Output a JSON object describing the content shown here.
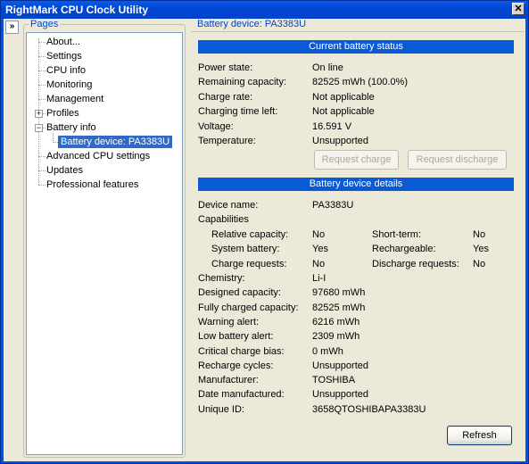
{
  "window": {
    "title": "RightMark CPU Clock Utility",
    "close_symbol": "✕",
    "collapse_symbol": "»"
  },
  "pages": {
    "legend": "Pages",
    "items": [
      {
        "label": "About..."
      },
      {
        "label": "Settings"
      },
      {
        "label": "CPU info"
      },
      {
        "label": "Monitoring"
      },
      {
        "label": "Management"
      },
      {
        "label": "Profiles",
        "expander": "+"
      },
      {
        "label": "Battery info",
        "expander": "−"
      },
      {
        "label": "Battery device: PA3383U",
        "selected": true
      },
      {
        "label": "Advanced CPU settings"
      },
      {
        "label": "Updates"
      },
      {
        "label": "Professional features"
      }
    ]
  },
  "content": {
    "title": "Battery device: PA3383U",
    "status_header": "Current battery status",
    "status": [
      {
        "label": "Power state:",
        "value": "On line"
      },
      {
        "label": "Remaining capacity:",
        "value": "82525 mWh (100.0%)"
      },
      {
        "label": "Charge rate:",
        "value": "Not applicable"
      },
      {
        "label": "Charging time left:",
        "value": "Not applicable"
      },
      {
        "label": "Voltage:",
        "value": "16.591 V"
      },
      {
        "label": "Temperature:",
        "value": "Unsupported"
      }
    ],
    "request_charge": "Request charge",
    "request_discharge": "Request discharge",
    "details_header": "Battery device details",
    "device_name_label": "Device name:",
    "device_name": "PA3383U",
    "capabilities_label": "Capabilities",
    "caps_left": [
      {
        "label": "Relative capacity:",
        "value": "No"
      },
      {
        "label": "System battery:",
        "value": "Yes"
      },
      {
        "label": "Charge requests:",
        "value": "No"
      }
    ],
    "caps_right": [
      {
        "label": "Short-term:",
        "value": "No"
      },
      {
        "label": "Rechargeable:",
        "value": "Yes"
      },
      {
        "label": "Discharge requests:",
        "value": "No"
      }
    ],
    "details": [
      {
        "label": "Chemistry:",
        "value": "Li-I"
      },
      {
        "label": "Designed capacity:",
        "value": "97680 mWh"
      },
      {
        "label": "Fully charged capacity:",
        "value": "82525 mWh"
      },
      {
        "label": "Warning alert:",
        "value": "6216 mWh"
      },
      {
        "label": "Low battery alert:",
        "value": "2309 mWh"
      },
      {
        "label": "Critical charge bias:",
        "value": "0 mWh"
      },
      {
        "label": "Recharge cycles:",
        "value": "Unsupported"
      },
      {
        "label": "Manufacturer:",
        "value": "TOSHIBA"
      },
      {
        "label": "Date manufactured:",
        "value": "Unsupported"
      },
      {
        "label": "Unique ID:",
        "value": "3658QTOSHIBAPA3383U"
      }
    ],
    "refresh": "Refresh"
  }
}
